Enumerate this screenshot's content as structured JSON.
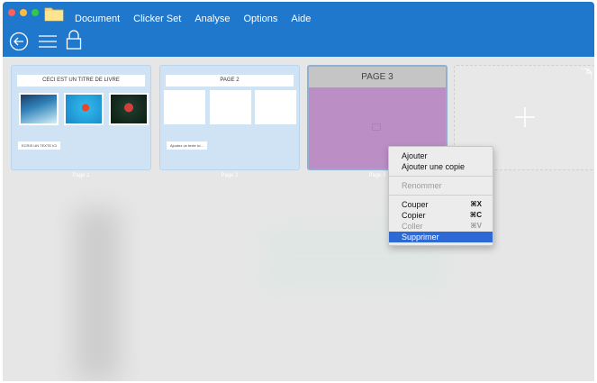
{
  "menubar": {
    "items": [
      "Document",
      "Clicker Set",
      "Analyse",
      "Options",
      "Aide"
    ]
  },
  "toolbar": {
    "icons": [
      "back-icon",
      "list-icon",
      "lock-icon"
    ]
  },
  "pages": [
    {
      "title": "CECI EST UN TITRE DE LIVRE",
      "caption": "ECRIS UN TEXTE ICI",
      "label": "Page 1"
    },
    {
      "title": "PAGE 2",
      "caption": "Ajoutez un texte ici...",
      "label": "Page 2"
    },
    {
      "title": "PAGE 3",
      "label": "Page 3"
    }
  ],
  "context_menu": {
    "items": [
      {
        "label": "Ajouter",
        "enabled": true
      },
      {
        "label": "Ajouter une copie",
        "enabled": true
      },
      {
        "label": "Renommer",
        "enabled": false
      },
      {
        "label": "Couper",
        "shortcut": "⌘X",
        "enabled": true
      },
      {
        "label": "Copier",
        "shortcut": "⌘C",
        "enabled": true
      },
      {
        "label": "Coller",
        "shortcut": "⌘V",
        "enabled": false
      },
      {
        "label": "Supprimer",
        "enabled": true,
        "selected": true
      }
    ]
  },
  "colors": {
    "topbar": "#1f78cc",
    "page_thumb": "#cfe3f5",
    "page3_body": "#bb8ec6",
    "selection": "#2e6ad6"
  }
}
